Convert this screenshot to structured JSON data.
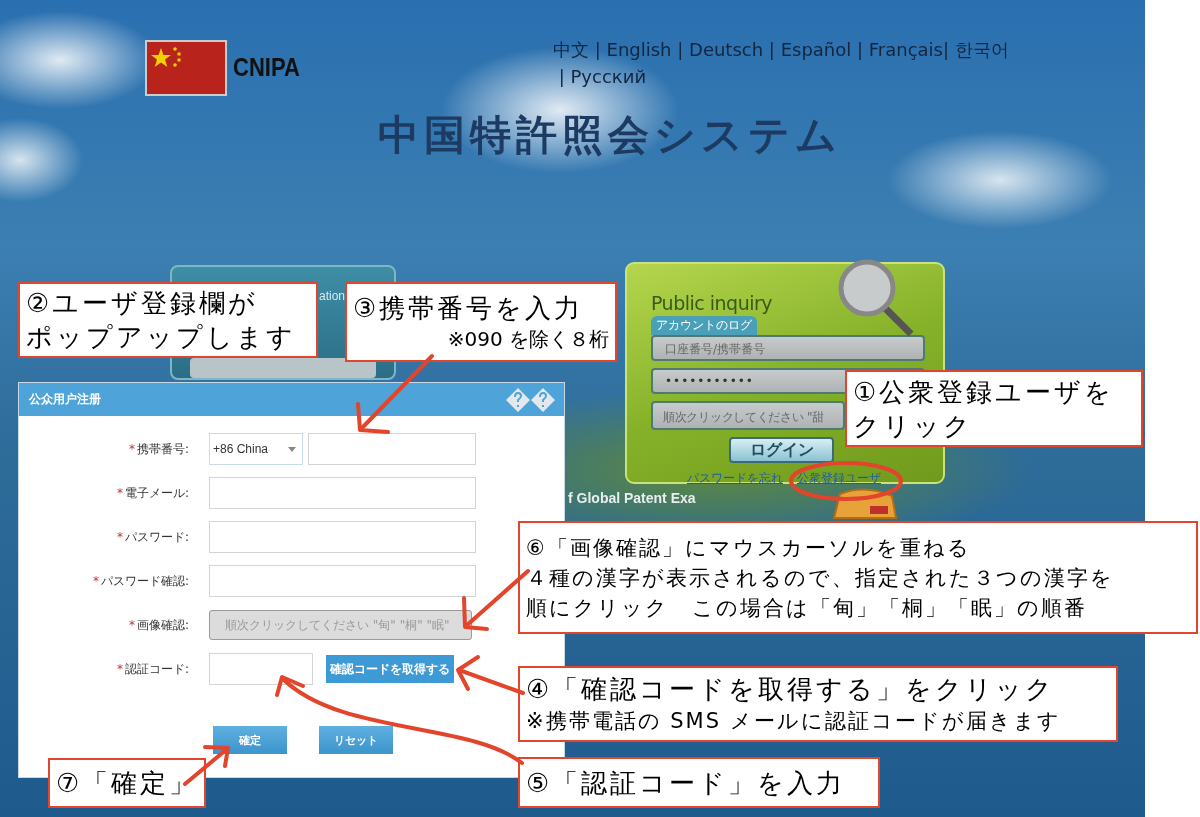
{
  "header": {
    "logo_text": "CNIPA",
    "languages": [
      "中文",
      "English",
      "Deutsch",
      "Español",
      "Français",
      "한국어",
      "Русский"
    ],
    "separators": [
      " | ",
      " | ",
      " | ",
      " | ",
      "| ",
      " | "
    ],
    "title": "中国特許照会システム"
  },
  "background_panel": {
    "title_fragment": "ation"
  },
  "login_panel": {
    "title": "Public inquiry",
    "tab": "アカウントのログ",
    "account_placeholder": "口座番号/携帯番号",
    "password_value": "•••••••••••",
    "captcha_placeholder": "順次クリックしてください \"甜",
    "login_button": "ログイン",
    "forgot_link": "パスワードを忘れ",
    "register_link": "公衆登録ユーザ",
    "footer_fragment": "f Global Patent Exa"
  },
  "dialog": {
    "title": "公众用户注册",
    "fields": [
      {
        "kind": "phone",
        "mark": "*",
        "label": "携帯番号:",
        "country": "+86 China"
      },
      {
        "kind": "text",
        "mark": "*",
        "label": "電子メール:"
      },
      {
        "kind": "text",
        "mark": "*",
        "label": "パスワード:"
      },
      {
        "kind": "text",
        "mark": "*",
        "label": "パスワード確認:"
      },
      {
        "kind": "captcha",
        "mark": "*",
        "label": "画像確認:",
        "placeholder": "順次クリックしてください \"甸\" \"桐\" \"眠\""
      },
      {
        "kind": "code",
        "mark": "*",
        "label": "認証コード:",
        "button": "確認コードを取得する"
      }
    ],
    "buttons": [
      "確定",
      "リセット"
    ]
  },
  "callouts": [
    {
      "lines": [
        {
          "kind": "main",
          "text": "②ユーザ登録欄が"
        },
        {
          "kind": "main",
          "text": "ポップアップします"
        }
      ]
    },
    {
      "lines": [
        {
          "kind": "main",
          "text": "③携帯番号を入力"
        },
        {
          "kind": "note",
          "text": "※090 を除く８桁"
        }
      ]
    },
    {
      "lines": [
        {
          "kind": "main",
          "text": "①公衆登録ユーザを"
        },
        {
          "kind": "main",
          "text": "クリック"
        }
      ]
    },
    {
      "lines": [
        {
          "kind": "small",
          "text": "⑥「画像確認」にマウスカーソルを重ねる"
        },
        {
          "kind": "small",
          "text": "４種の漢字が表示されるので、指定された３つの漢字を"
        },
        {
          "kind": "small",
          "text": "順にクリック　この場合は「甸」「桐」「眠」の順番"
        }
      ]
    },
    {
      "lines": [
        {
          "kind": "main",
          "text": "④「確認コードを取得する」をクリック"
        },
        {
          "kind": "small",
          "text": "※携帯電話の SMS メールに認証コードが届きます"
        }
      ]
    },
    {
      "lines": [
        {
          "kind": "main",
          "text": "⑦「確定」"
        }
      ]
    },
    {
      "lines": [
        {
          "kind": "main",
          "text": "⑤「認証コード」を入力"
        }
      ]
    }
  ]
}
